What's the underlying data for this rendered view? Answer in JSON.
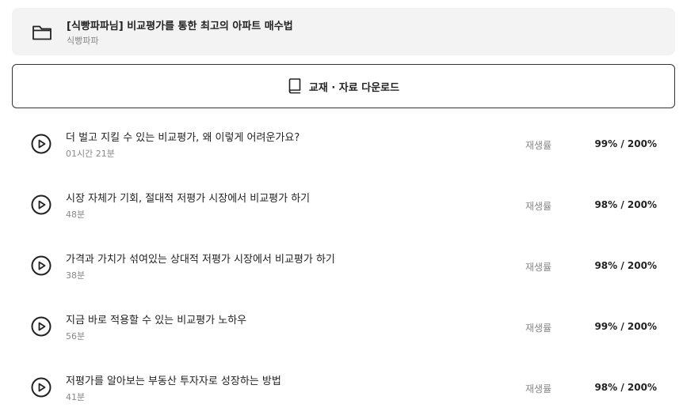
{
  "course": {
    "icon": "folder-icon",
    "title": "[식빵파파님] 비교평가를 통한 최고의 아파트 매수법",
    "author": "식빵파파"
  },
  "download": {
    "icon": "book-icon",
    "label": "교재 · 자료 다운로드"
  },
  "lessons": [
    {
      "title": "더 벌고 지킬 수 있는 비교평가, 왜 이렇게 어려운가요?",
      "duration": "01시간 21분",
      "rate_label": "재생률",
      "rate": "99% / 200%"
    },
    {
      "title": "시장 자체가 기회, 절대적 저평가 시장에서 비교평가 하기",
      "duration": "48분",
      "rate_label": "재생률",
      "rate": "98% / 200%"
    },
    {
      "title": "가격과 가치가 섞여있는 상대적 저평가 시장에서 비교평가 하기",
      "duration": "38분",
      "rate_label": "재생률",
      "rate": "98% / 200%"
    },
    {
      "title": "지금 바로 적용할 수 있는 비교평가 노하우",
      "duration": "56분",
      "rate_label": "재생률",
      "rate": "99% / 200%"
    },
    {
      "title": "저평가를 알아보는 부동산 투자자로 성장하는 방법",
      "duration": "41분",
      "rate_label": "재생률",
      "rate": "98% / 200%"
    }
  ]
}
